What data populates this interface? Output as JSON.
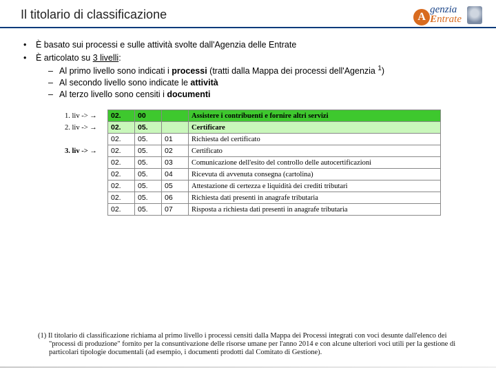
{
  "header": {
    "title": "Il titolario di classificazione",
    "logo": {
      "name_top": "genzia",
      "name_bottom": "ntrate",
      "cap_a": "A",
      "cap_e": "E"
    }
  },
  "bullets": {
    "b1": "È basato sui processi e sulle attività svolte dall'Agenzia delle Entrate",
    "b2_pre": "È articolato su ",
    "b2_u": "3 livelli",
    "b2_post": ":",
    "sub1_pre": "Al primo livello sono indicati i ",
    "sub1_b": "processi",
    "sub1_post": " (tratti dalla Mappa dei processi dell'Agenzia ",
    "sub1_sup": "1",
    "sub1_close": ")",
    "sub2_pre": "Al secondo livello sono indicate le ",
    "sub2_b": "attività",
    "sub3_pre": "Al terzo livello sono censiti i ",
    "sub3_b": "documenti"
  },
  "table": {
    "r1": {
      "label": "1. liv -> ",
      "arrow": "→",
      "c1": "02.",
      "c2": "00",
      "c3": "",
      "desc": "Assistere i contribuenti e fornire altri servizi"
    },
    "r2": {
      "label": "2. liv -> ",
      "arrow": "→",
      "c1": "02.",
      "c2": "05.",
      "c3": "",
      "desc": "Certificare"
    },
    "r3": {
      "label": "",
      "c1": "02.",
      "c2": "05.",
      "c3": "01",
      "desc": "Richiesta del certificato"
    },
    "r4": {
      "label": "3. liv -> ",
      "arrow": "→",
      "c1": "02.",
      "c2": "05.",
      "c3": "02",
      "desc": "Certificato"
    },
    "r5": {
      "c1": "02.",
      "c2": "05.",
      "c3": "03",
      "desc": "Comunicazione dell'esito del controllo delle autocertificazioni"
    },
    "r6": {
      "c1": "02.",
      "c2": "05.",
      "c3": "04",
      "desc": "Ricevuta di avvenuta consegna (cartolina)"
    },
    "r7": {
      "c1": "02.",
      "c2": "05.",
      "c3": "05",
      "desc": "Attestazione di certezza e liquidità dei crediti tributari"
    },
    "r8": {
      "c1": "02.",
      "c2": "05.",
      "c3": "06",
      "desc": "Richiesta dati presenti in anagrafe tributaria"
    },
    "r9": {
      "c1": "02.",
      "c2": "05.",
      "c3": "07",
      "desc": "Risposta a richiesta dati presenti in anagrafe tributaria"
    }
  },
  "footnote": {
    "text": "(1) Il titolario di classificazione richiama al primo livello i processi censiti dalla Mappa dei Processi integrati con voci desunte dall'elenco dei \"processi di produzione\" fornito per la consuntivazione delle risorse umane per l'anno 2014 e con alcune ulteriori voci utili per la gestione di particolari tipologie documentali (ad esempio, i documenti prodotti dal Comitato di Gestione)."
  }
}
